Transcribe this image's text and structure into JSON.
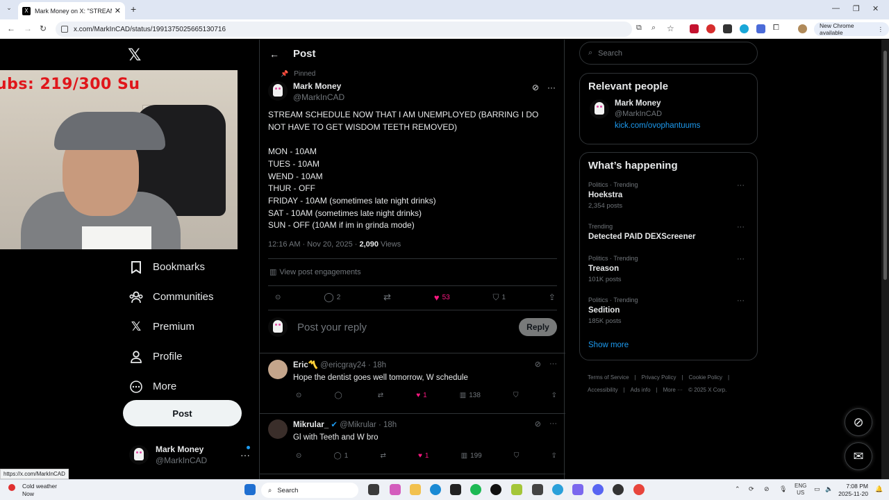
{
  "browser": {
    "tab_title": "Mark Money on X: \"STREAM SC",
    "url": "x.com/MarkInCAD/status/1991375025665130716",
    "badge": "New Chrome available"
  },
  "left": {
    "webcam_overlay": "ubs: 219/300  Su",
    "nav": [
      {
        "label": "Bookmarks",
        "icon": "bookmark-icon"
      },
      {
        "label": "Communities",
        "icon": "communities-icon"
      },
      {
        "label": "Premium",
        "icon": "x-premium-icon"
      },
      {
        "label": "Profile",
        "icon": "profile-icon"
      },
      {
        "label": "More",
        "icon": "more-icon"
      }
    ],
    "post_button": "Post",
    "account_name": "Mark Money",
    "account_handle": "@MarkInCAD"
  },
  "post": {
    "header": "Post",
    "pinned": "Pinned",
    "author_name": "Mark Money",
    "author_handle": "@MarkInCAD",
    "text": "STREAM SCHEDULE NOW THAT I AM UNEMPLOYED (BARRING I DO NOT HAVE TO GET WISDOM TEETH REMOVED)\n\nMON - 10AM\nTUES - 10AM\nWEND - 10AM\nTHUR - OFF\nFRIDAY - 10AM (sometimes late night drinks)\nSAT - 10AM (sometimes late night drinks)\nSUN - OFF (10AM if im in grinda mode)",
    "time": "12:16 AM · Nov 20, 2025 · ",
    "views_count": "2,090",
    "views_label": " Views",
    "engagements": "View post engagements",
    "replies": "2",
    "likes": "53",
    "bookmarks": "1",
    "reply_placeholder": "Post your reply",
    "reply_button": "Reply"
  },
  "replies": [
    {
      "name": "Eric〽️",
      "handle": "@ericgray24",
      "time": "· 18h",
      "text": "Hope the dentist goes well tomorrow, W schedule",
      "replies": "",
      "likes": "1",
      "views": "138"
    },
    {
      "name": "Mikrular_",
      "handle": "@Mikrular",
      "time": "· 18h",
      "text": "Gl with Teeth and W bro",
      "replies": "1",
      "likes": "1",
      "views": "199"
    }
  ],
  "right": {
    "search_placeholder": "Search",
    "relevant_title": "Relevant people",
    "relevant_name": "Mark Money",
    "relevant_handle": "@MarkInCAD",
    "relevant_link": "kick.com/ovophantuums",
    "happening_title": "What’s happening",
    "trends": [
      {
        "context": "Politics · Trending",
        "name": "Hoekstra",
        "posts": "2,354 posts"
      },
      {
        "context": "Trending",
        "name": "Detected PAID DEXScreener",
        "posts": ""
      },
      {
        "context": "Politics · Trending",
        "name": "Treason",
        "posts": "101K posts"
      },
      {
        "context": "Politics · Trending",
        "name": "Sedition",
        "posts": "185K posts"
      }
    ],
    "show_more": "Show more",
    "footer": [
      "Terms of Service",
      "|",
      "Privacy Policy",
      "|",
      "Cookie Policy",
      "|",
      "Accessibility",
      "|",
      "Ads info",
      "|",
      "More ···",
      "© 2025 X Corp."
    ]
  },
  "status_url": "https://x.com/MarkInCAD",
  "taskbar": {
    "weather_title": "Cold weather",
    "weather_sub": "Now",
    "search": "Search",
    "lang1": "ENG",
    "lang2": "US",
    "time": "7:08 PM",
    "date": "2025-11-20"
  }
}
